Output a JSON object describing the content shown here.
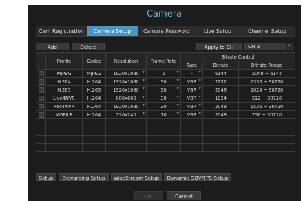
{
  "title": "Camera",
  "tabs": [
    "Cam Registration",
    "Camera Setup",
    "Camera Password",
    "Live Setup",
    "Channel Setup"
  ],
  "active_tab": "Camera Setup",
  "toolbar": {
    "add": "Add",
    "delete": "Delete",
    "apply": "Apply to CH",
    "channel": "CH 3"
  },
  "table": {
    "headers": {
      "profile": "Profile",
      "codec": "Codec",
      "resolution": "Resolution",
      "frame_rate": "Frame Rate",
      "bitrate_control": "Bitrate Control",
      "type": "Type",
      "bitrate": "Bitrate",
      "range": "Bitrate Range"
    },
    "rows": [
      {
        "profile": "MJPEG",
        "codec": "MJPEG",
        "resolution": "1920x1080",
        "frame_rate": "2",
        "type": "-",
        "bitrate": "6144",
        "range": "2048 ~ 6144"
      },
      {
        "profile": "H.264",
        "codec": "H.264",
        "resolution": "1920x1080",
        "frame_rate": "30",
        "type": "VBR",
        "bitrate": "2252",
        "range": "1536 ~ 30720"
      },
      {
        "profile": "H.265",
        "codec": "H.265",
        "resolution": "1920x1080",
        "frame_rate": "30",
        "type": "VBR",
        "bitrate": "2048",
        "range": "1024 ~ 30720"
      },
      {
        "profile": "Live4NVR",
        "codec": "H.264",
        "resolution": "800x600",
        "frame_rate": "30",
        "type": "VBR",
        "bitrate": "1024",
        "range": "512 ~ 30720"
      },
      {
        "profile": "Rec4NVR",
        "codec": "H.264",
        "resolution": "1920x1080",
        "frame_rate": "30",
        "type": "VBR",
        "bitrate": "2048",
        "range": "1536 ~ 30720"
      },
      {
        "profile": "MOBILE",
        "codec": "H.264",
        "resolution": "320x240",
        "frame_rate": "10",
        "type": "VBR",
        "bitrate": "2048",
        "range": "256 ~ 30720"
      }
    ]
  },
  "bottom_buttons": {
    "setup": "Setup",
    "dewarping": "Dewarping Setup",
    "wisestream": "WiseStream Setup",
    "dynamic": "Dynamic GOV/FPS Setup"
  },
  "ok": "OK",
  "cancel": "Cancel",
  "colors": {
    "accent": "#4b96c8",
    "title": "#5fb8e6",
    "background": "#1c1c1c"
  }
}
